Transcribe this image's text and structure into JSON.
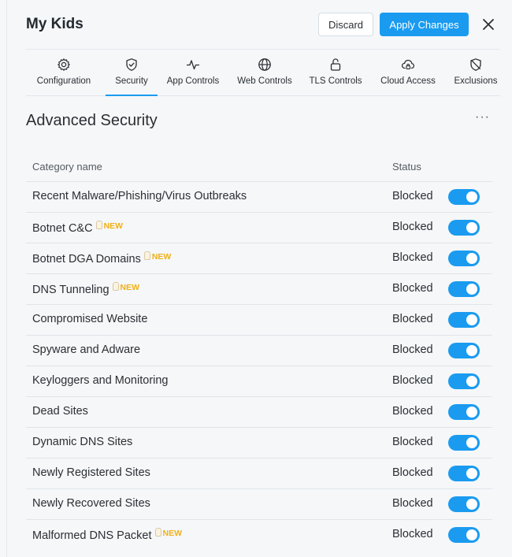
{
  "header": {
    "title": "My Kids",
    "discard_label": "Discard",
    "apply_label": "Apply Changes"
  },
  "tabs": [
    {
      "label": "Configuration",
      "icon": "gear-icon"
    },
    {
      "label": "Security",
      "icon": "shield-check-icon",
      "active": true
    },
    {
      "label": "App Controls",
      "icon": "pulse-icon"
    },
    {
      "label": "Web Controls",
      "icon": "globe-icon"
    },
    {
      "label": "TLS Controls",
      "icon": "lock-open-icon"
    },
    {
      "label": "Cloud Access",
      "icon": "cloud-lock-icon"
    },
    {
      "label": "Exclusions",
      "icon": "shield-off-icon"
    }
  ],
  "section": {
    "title": "Advanced Security",
    "more_label": "···"
  },
  "table": {
    "columns": {
      "name": "Category name",
      "status": "Status"
    },
    "new_label": "NEW",
    "rows": [
      {
        "name": "Recent Malware/Phishing/Virus Outbreaks",
        "status": "Blocked",
        "is_new": false,
        "enabled": true
      },
      {
        "name": "Botnet C&C",
        "status": "Blocked",
        "is_new": true,
        "enabled": true
      },
      {
        "name": "Botnet DGA Domains",
        "status": "Blocked",
        "is_new": true,
        "enabled": true
      },
      {
        "name": "DNS Tunneling",
        "status": "Blocked",
        "is_new": true,
        "enabled": true
      },
      {
        "name": "Compromised Website",
        "status": "Blocked",
        "is_new": false,
        "enabled": true
      },
      {
        "name": "Spyware and Adware",
        "status": "Blocked",
        "is_new": false,
        "enabled": true
      },
      {
        "name": "Keyloggers and Monitoring",
        "status": "Blocked",
        "is_new": false,
        "enabled": true
      },
      {
        "name": "Dead Sites",
        "status": "Blocked",
        "is_new": false,
        "enabled": true
      },
      {
        "name": "Dynamic DNS Sites",
        "status": "Blocked",
        "is_new": false,
        "enabled": true
      },
      {
        "name": "Newly Registered Sites",
        "status": "Blocked",
        "is_new": false,
        "enabled": true
      },
      {
        "name": "Newly Recovered Sites",
        "status": "Blocked",
        "is_new": false,
        "enabled": true
      },
      {
        "name": "Malformed DNS Packet",
        "status": "Blocked",
        "is_new": true,
        "enabled": true
      }
    ]
  },
  "colors": {
    "accent": "#1a9bf0",
    "new_badge": "#f2b014",
    "background": "#f5f7f9"
  }
}
